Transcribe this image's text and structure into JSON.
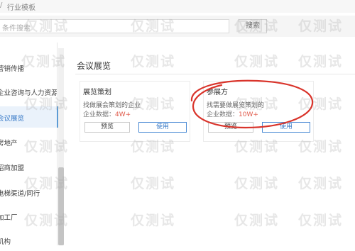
{
  "breadcrumb": {
    "separator": "/",
    "current": "行业模板"
  },
  "search": {
    "placeholder": "条件搜索",
    "button_label": "搜索"
  },
  "sidebar": {
    "items": [
      {
        "label": "营销传播"
      },
      {
        "label": "企业咨询与人力资源"
      },
      {
        "label": "会议展览",
        "active": true
      },
      {
        "label": "房地产"
      },
      {
        "label": "招商加盟"
      },
      {
        "label": "电梯渠道/同行"
      },
      {
        "label": "加工厂"
      },
      {
        "label": "机构"
      }
    ]
  },
  "main": {
    "title": "会议展览",
    "cards": [
      {
        "name": "展览策划",
        "description": "找做展会策划的企业",
        "users_label": "企业数据：",
        "users_value": "4W+",
        "preview_label": "预览",
        "use_label": "使用"
      },
      {
        "name": "参展方",
        "description": "找需要做展览策划的",
        "users_label": "企业数据：",
        "users_value": "10W+",
        "preview_label": "预览",
        "use_label": "使用"
      }
    ]
  },
  "annotation": {
    "color": "#d9342b"
  },
  "watermark": {
    "text": "仅测试"
  },
  "colors": {
    "accent": "#3a7bc8",
    "highlight_number": "#e05a4a"
  }
}
